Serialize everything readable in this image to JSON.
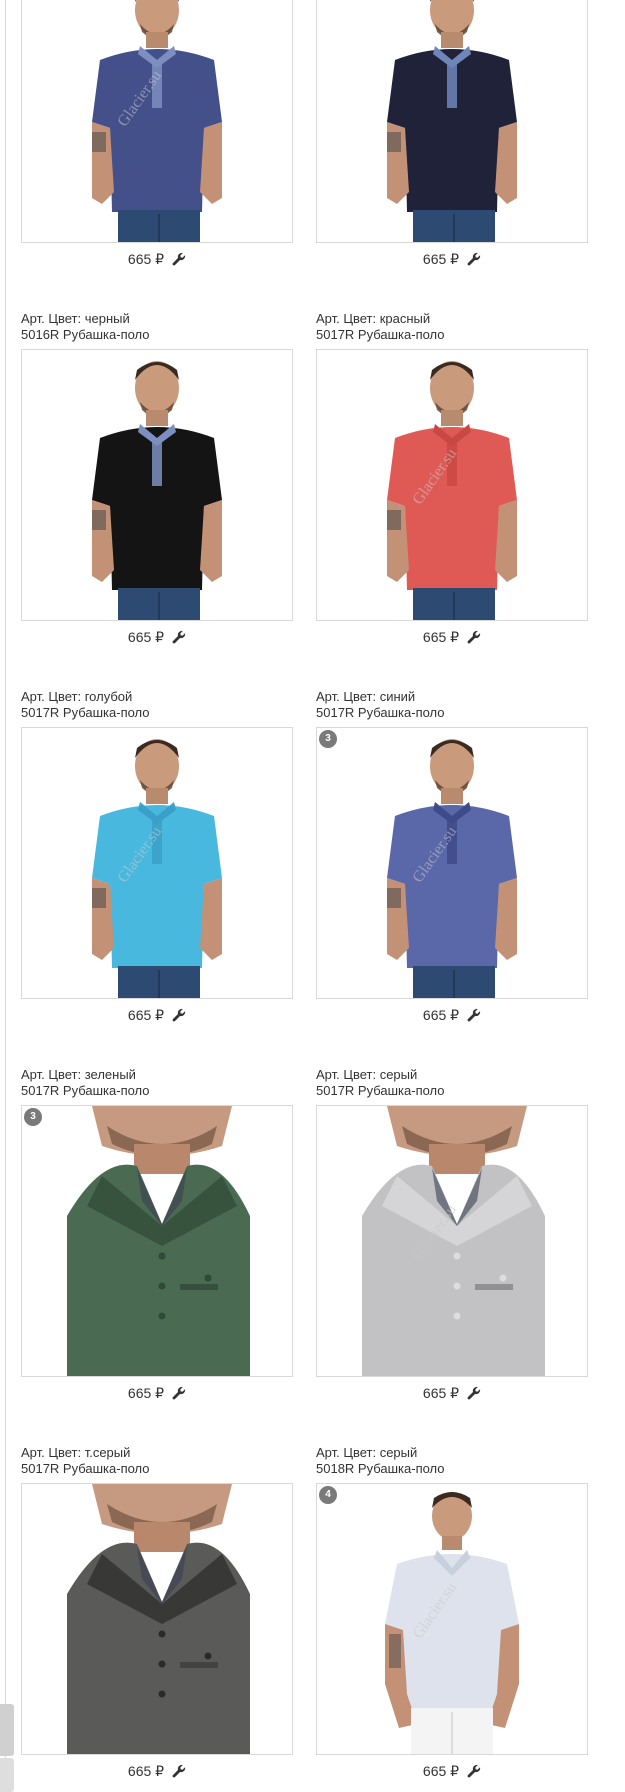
{
  "products": [
    {
      "title_line1": "",
      "title_line2": "",
      "price": "665 ₽",
      "badge": "",
      "watermark": "Glacier.su",
      "shirt_color": "#43508a",
      "accent": "#7d8fc0",
      "kind": "full"
    },
    {
      "title_line1": "",
      "title_line2": "",
      "price": "665 ₽",
      "badge": "",
      "watermark": "",
      "shirt_color": "#1f2238",
      "accent": "#6f86b8",
      "kind": "full"
    },
    {
      "title_line1": "Арт. Цвет: черный",
      "title_line2": "5016R Рубашка-поло",
      "price": "665 ₽",
      "badge": "",
      "watermark": "",
      "shirt_color": "#141414",
      "accent": "#7d8fc0",
      "kind": "full"
    },
    {
      "title_line1": "Арт. Цвет: красный",
      "title_line2": "5017R Рубашка-поло",
      "price": "665 ₽",
      "badge": "",
      "watermark": "Glacier.su",
      "shirt_color": "#e05a55",
      "accent": "#c94843",
      "kind": "full"
    },
    {
      "title_line1": "Арт. Цвет: голубой",
      "title_line2": "5017R Рубашка-поло",
      "price": "665 ₽",
      "badge": "",
      "watermark": "Glacier.su",
      "shirt_color": "#49b8df",
      "accent": "#3aa0c8",
      "kind": "full"
    },
    {
      "title_line1": "Арт. Цвет: синий",
      "title_line2": "5017R Рубашка-поло",
      "price": "665 ₽",
      "badge": "3",
      "watermark": "Glacier.su",
      "shirt_color": "#5a67a8",
      "accent": "#3e4a8a",
      "kind": "full"
    },
    {
      "title_line1": "Арт. Цвет: зеленый",
      "title_line2": "5017R Рубашка-поло",
      "price": "665 ₽",
      "badge": "3",
      "watermark": "",
      "shirt_color": "#4a6a52",
      "accent": "#2f4a36",
      "kind": "close"
    },
    {
      "title_line1": "Арт. Цвет: серый",
      "title_line2": "5017R Рубашка-поло",
      "price": "665 ₽",
      "badge": "",
      "watermark": "Glacier.su",
      "shirt_color": "#c2c2c4",
      "accent": "#dddddf",
      "kind": "close"
    },
    {
      "title_line1": "Арт. Цвет: т.серый",
      "title_line2": "5017R Рубашка-поло",
      "price": "665 ₽",
      "badge": "",
      "watermark": "",
      "shirt_color": "#5a5a58",
      "accent": "#2a2a2a",
      "kind": "close"
    },
    {
      "title_line1": "Арт. Цвет: серый",
      "title_line2": "5018R Рубашка-поло",
      "price": "665 ₽",
      "badge": "4",
      "watermark": "Glacier.su",
      "shirt_color": "#dde2ec",
      "accent": "#c8cfdd",
      "kind": "white"
    }
  ]
}
